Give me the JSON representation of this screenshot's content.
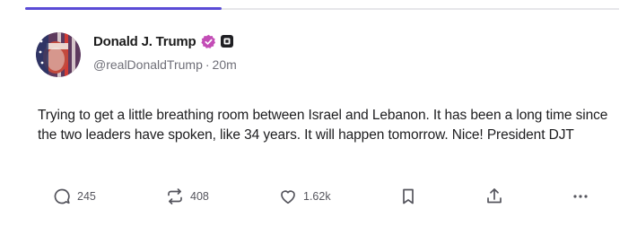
{
  "post": {
    "author": {
      "display_name": "Donald J. Trump",
      "handle": "@realDonaldTrump",
      "separator": "·",
      "time_ago": "20m"
    },
    "body": "Trying to get a little breathing room between Israel and Lebanon. It has been a long time since the two leaders have spoken, like 34 years. It will happen tomorrow. Nice! President DJT",
    "actions": {
      "replies": "245",
      "reposts": "408",
      "likes": "1.62k"
    }
  },
  "icons": {
    "verified_badge": "verified-badge-icon",
    "affiliate_badge": "affiliate-badge-icon",
    "reply": "reply-icon",
    "repost": "repost-icon",
    "like": "heart-icon",
    "bookmark": "bookmark-icon",
    "share": "share-icon",
    "more": "more-icon"
  },
  "colors": {
    "accent": "#5a4bd6",
    "verified": "#c34db6",
    "muted_text": "#6f6f78"
  }
}
